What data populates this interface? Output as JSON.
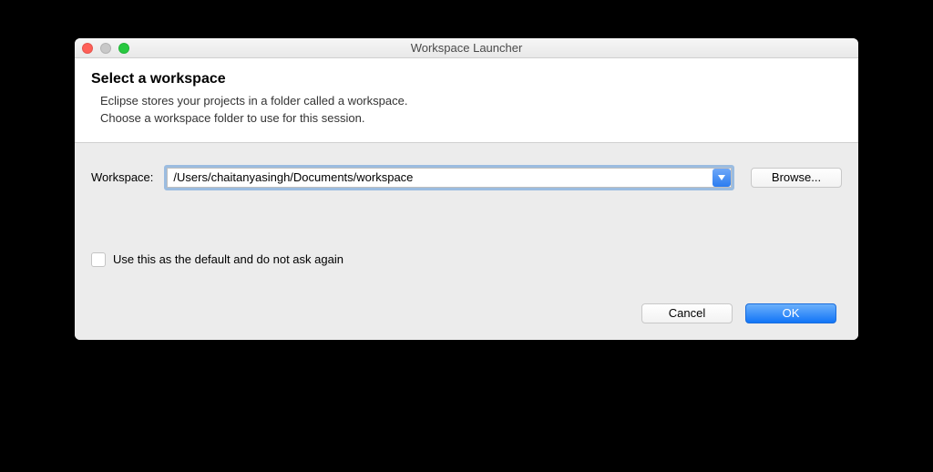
{
  "window": {
    "title": "Workspace Launcher"
  },
  "header": {
    "title": "Select a workspace",
    "line1": "Eclipse stores your projects in a folder called a workspace.",
    "line2": "Choose a workspace folder to use for this session."
  },
  "form": {
    "workspace_label": "Workspace:",
    "workspace_value": "/Users/chaitanyasingh/Documents/workspace",
    "browse_label": "Browse...",
    "default_checkbox_label": "Use this as the default and do not ask again"
  },
  "buttons": {
    "cancel": "Cancel",
    "ok": "OK"
  }
}
